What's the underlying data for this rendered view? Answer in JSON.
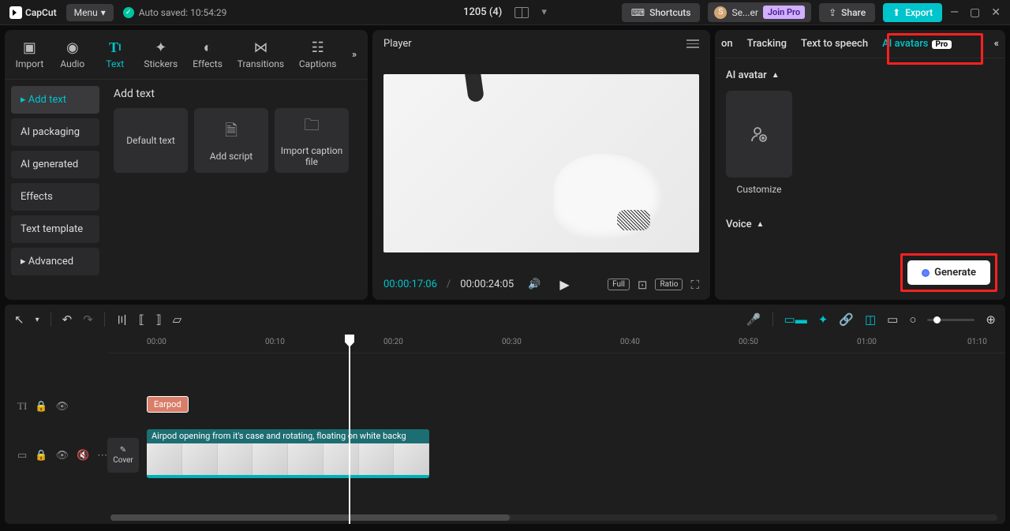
{
  "titlebar": {
    "app_name": "CapCut",
    "menu_label": "Menu",
    "autosave": "Auto saved: 10:54:29",
    "project_title": "1205 (4)",
    "shortcuts": "Shortcuts",
    "user": "Se...er",
    "join_pro": "Join Pro",
    "share": "Share",
    "export": "Export"
  },
  "tabs": {
    "import": "Import",
    "audio": "Audio",
    "text": "Text",
    "stickers": "Stickers",
    "effects": "Effects",
    "transitions": "Transitions",
    "captions": "Captions"
  },
  "sidebar": {
    "items": [
      "Add text",
      "AI packaging",
      "AI generated",
      "Effects",
      "Text template",
      "Advanced"
    ]
  },
  "content": {
    "heading": "Add text",
    "tiles": {
      "default": "Default text",
      "script": "Add script",
      "caption": "Import caption file"
    }
  },
  "player": {
    "title": "Player",
    "current": "00:00:17:06",
    "total": "00:00:24:05",
    "full": "Full",
    "ratio": "Ratio"
  },
  "right": {
    "tabs": {
      "on": "on",
      "tracking": "Tracking",
      "tts": "Text to speech",
      "avatars": "AI avatars",
      "pro": "Pro"
    },
    "avatar_heading": "AI avatar",
    "customize": "Customize",
    "voice_heading": "Voice",
    "generate": "Generate"
  },
  "timeline": {
    "marks": [
      "00:00",
      "00:10",
      "00:20",
      "00:30",
      "00:40",
      "00:50",
      "01:00",
      "01:10"
    ],
    "text_clip": "Earpod",
    "video_label": "Airpod opening from it's case and rotating, floating on white backg",
    "cover": "Cover"
  }
}
